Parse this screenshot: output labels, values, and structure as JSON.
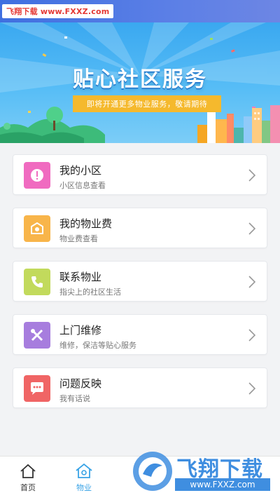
{
  "watermark": {
    "top_text": "飞翔下载 www.FXXZ.com",
    "bottom_logo": "飞翔下载",
    "bottom_url": "www.FXXZ.com"
  },
  "banner": {
    "title": "贴心社区服务",
    "subtitle": "即将开通更多物业服务，敬请期待"
  },
  "menu": {
    "items": [
      {
        "title": "我的小区",
        "subtitle": "小区信息查看",
        "icon": "alert-icon",
        "color": "#f06bc0"
      },
      {
        "title": "我的物业费",
        "subtitle": "物业费查看",
        "icon": "wallet-icon",
        "color": "#f8b54a"
      },
      {
        "title": "联系物业",
        "subtitle": "指尖上的社区生活",
        "icon": "phone-icon",
        "color": "#c2da5c"
      },
      {
        "title": "上门维修",
        "subtitle": "维修，保洁等贴心服务",
        "icon": "tools-icon",
        "color": "#a77dde"
      },
      {
        "title": "问题反映",
        "subtitle": "我有话说",
        "icon": "chat-icon",
        "color": "#f06565"
      }
    ]
  },
  "tabbar": {
    "tabs": [
      {
        "label": "首页",
        "icon": "home-icon",
        "active": false
      },
      {
        "label": "物业",
        "icon": "building-icon",
        "active": true
      }
    ],
    "active_color": "#39a3e6"
  }
}
